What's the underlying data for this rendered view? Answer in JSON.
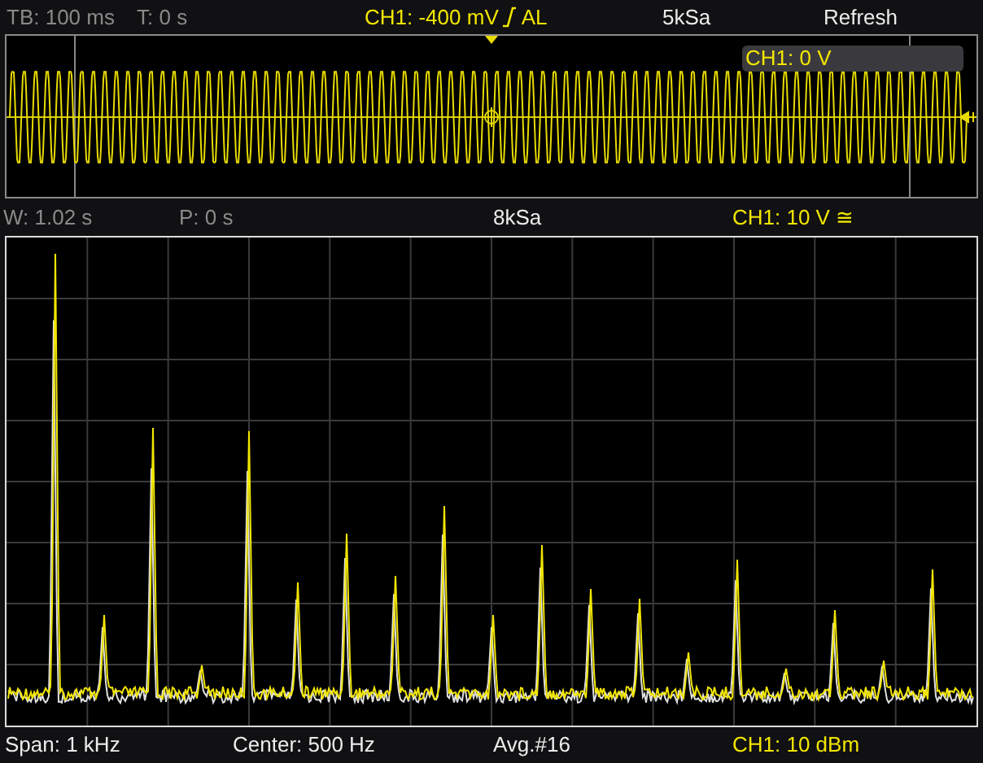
{
  "top_bar": {
    "timebase": "TB: 100 ms",
    "trigger_time": "T: 0 s",
    "trigger": {
      "label": "CH1: -400 mV",
      "mode": "AL"
    },
    "sample_rate": "5kSa",
    "refresh": "Refresh"
  },
  "waveform": {
    "channel_label": "CH1: 0 V"
  },
  "zoom_bar": {
    "window": "W: 1.02 s",
    "position": "P: 0 s",
    "sample_rate": "8kSa",
    "channel_scale": "CH1: 10 V ≅"
  },
  "status_bar": {
    "span": "Span: 1 kHz",
    "center": "Center: 500 Hz",
    "average": "Avg.#16",
    "channel_ref": "CH1: 10 dBm"
  }
}
